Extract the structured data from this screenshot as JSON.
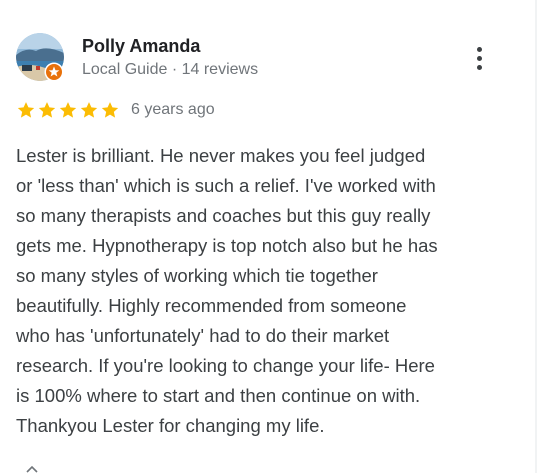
{
  "reviewer": {
    "name": "Polly Amanda",
    "meta": "Local Guide · 14 reviews",
    "avatar_icon": "profile-photo-beach",
    "badge_icon": "local-guide-star-badge"
  },
  "menu": {
    "icon": "more-vertical-icon"
  },
  "rating": {
    "stars": 5,
    "max": 5,
    "star_color": "#fbbc04",
    "date": "6 years ago"
  },
  "review": {
    "text": "Lester is brilliant. He never makes you feel judged\nor 'less than' which is such a relief. I've worked with\nso many therapists and coaches but this guy really\ngets me. Hypnotherapy is top notch also but he has\nso many styles of working which tie together\nbeautifully. Highly recommended from someone\nwho has 'unfortunately' had to do their market\nresearch. If you're looking to change your life- Here\nis 100% where to start and then continue on with.\nThankyou Lester for changing my life."
  },
  "colors": {
    "name": "#202124",
    "meta": "#70757a",
    "body": "#3c4043",
    "badge": "#e8710a"
  }
}
